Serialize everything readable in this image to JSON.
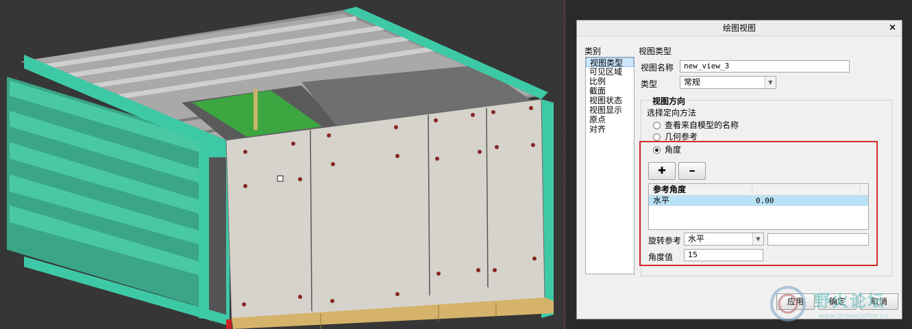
{
  "dialog": {
    "title": "绘图视图",
    "close_glyph": "×",
    "category_label": "类别",
    "categories": [
      "视图类型",
      "可见区域",
      "比例",
      "截面",
      "视图状态",
      "视图显示",
      "原点",
      "对齐"
    ],
    "section_title": "视图类型",
    "view_name_label": "视图名称",
    "view_name_value": "new_view_3",
    "type_label": "类型",
    "type_value": "常规",
    "orientation_title": "视图方向",
    "orientation_method_label": "选择定向方法",
    "orientation_options": [
      "查看来自模型的名称",
      "几何参考",
      "角度"
    ],
    "selected_option": "角度",
    "add_glyph": "✚",
    "remove_glyph": "━",
    "table_header": "参考角度",
    "table_row": {
      "name": "水平",
      "value": "0.00"
    },
    "rotation_ref_label": "旋转参考",
    "rotation_ref_value": "水平",
    "angle_value_label": "角度值",
    "angle_value": "15",
    "apply_label": "应用",
    "ok_label": "确定",
    "cancel_label": "取消"
  },
  "watermark": {
    "text": "野火论坛",
    "url": "www.proewildfire.cn"
  },
  "colors": {
    "highlight_box": "#d42a2a",
    "selected_row": "#b9e2f6",
    "cad_frame": "#3ec9a6",
    "cad_panel": "#d5d3cb"
  }
}
